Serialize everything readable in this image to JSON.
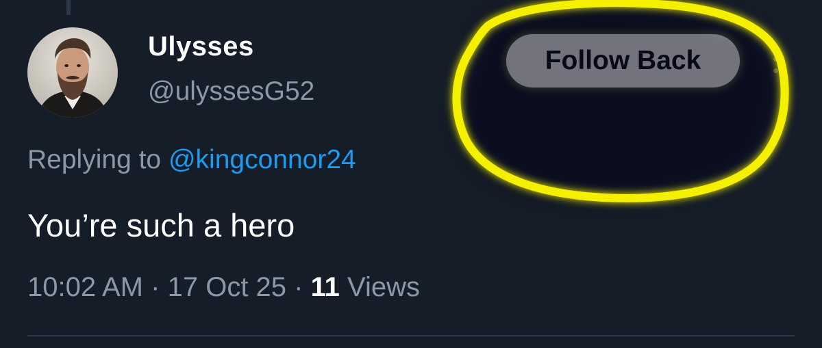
{
  "tweet": {
    "author": {
      "display_name": "Ulysses",
      "handle": "@ulyssesG52"
    },
    "follow_button_label": "Follow Back",
    "reply": {
      "prefix": "Replying to",
      "target": "@kingconnor24"
    },
    "text": "You’re such a hero",
    "meta": {
      "time": "10:02 AM",
      "separator": "·",
      "date": "17 Oct 25",
      "views_count": "11",
      "views_label": "Views"
    }
  },
  "colors": {
    "background": "#151d29",
    "primary_text": "#ffffff",
    "secondary_text": "#8b98a5",
    "link": "#1d9bf0",
    "highlight_circle": "#f5f000"
  },
  "icons": {
    "more": "more-vertical-icon"
  }
}
